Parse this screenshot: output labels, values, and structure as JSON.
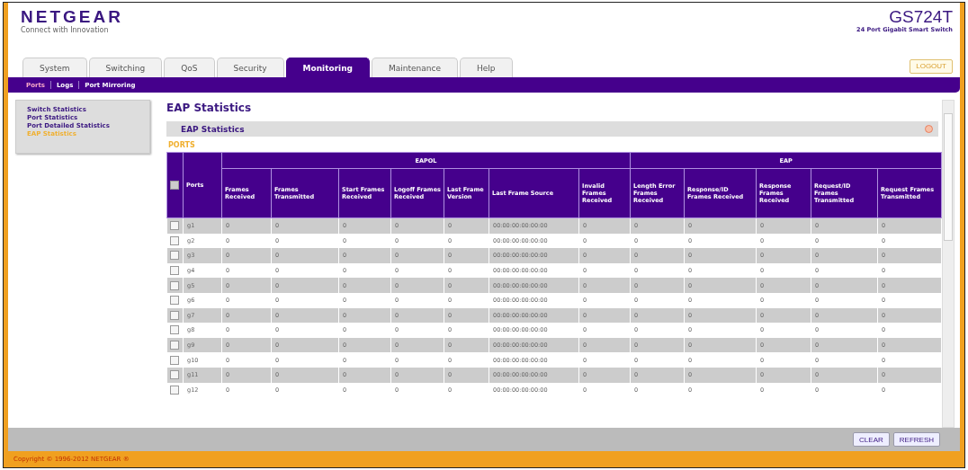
{
  "header": {
    "brand": "NETGEAR",
    "tagline": "Connect with Innovation",
    "model": "GS724T",
    "model_desc": "24 Port Gigabit Smart Switch",
    "logout": "LOGOUT"
  },
  "tabs": [
    {
      "label": "System",
      "selected": false
    },
    {
      "label": "Switching",
      "selected": false
    },
    {
      "label": "QoS",
      "selected": false
    },
    {
      "label": "Security",
      "selected": false
    },
    {
      "label": "Monitoring",
      "selected": true
    },
    {
      "label": "Maintenance",
      "selected": false
    },
    {
      "label": "Help",
      "selected": false
    }
  ],
  "subnav": [
    {
      "label": "Ports",
      "selected": true
    },
    {
      "label": "Logs",
      "selected": false
    },
    {
      "label": "Port Mirroring",
      "selected": false
    }
  ],
  "sidebar": {
    "items": [
      {
        "label": "Switch Statistics",
        "selected": false
      },
      {
        "label": "Port Statistics",
        "selected": false
      },
      {
        "label": "Port Detailed Statistics",
        "selected": false
      },
      {
        "label": "EAP Statistics",
        "selected": true
      }
    ]
  },
  "page_title": "EAP Statistics",
  "panel": {
    "title": "EAP Statistics",
    "section_label": "PORTS",
    "table": {
      "select_all_checked": false,
      "port_column": "Ports",
      "groups": [
        {
          "label": "EAPOL",
          "columns": [
            "Frames Received",
            "Frames Transmitted",
            "Start Frames Received",
            "Logoff Frames Received",
            "Last Frame Version",
            "Last Frame Source",
            "Invalid Frames Received"
          ]
        },
        {
          "label": "EAP",
          "columns": [
            "Length Error Frames Received",
            "Response/ID Frames Received",
            "Response Frames Received",
            "Request/ID Frames Transmitted",
            "Request Frames Transmitted"
          ]
        }
      ],
      "rows": [
        {
          "checked": false,
          "cells": [
            "g1",
            "0",
            "0",
            "0",
            "0",
            "0",
            "00:00:00:00:00:00",
            "0",
            "0",
            "0",
            "0",
            "0",
            "0"
          ]
        },
        {
          "checked": false,
          "cells": [
            "g2",
            "0",
            "0",
            "0",
            "0",
            "0",
            "00:00:00:00:00:00",
            "0",
            "0",
            "0",
            "0",
            "0",
            "0"
          ]
        },
        {
          "checked": false,
          "cells": [
            "g3",
            "0",
            "0",
            "0",
            "0",
            "0",
            "00:00:00:00:00:00",
            "0",
            "0",
            "0",
            "0",
            "0",
            "0"
          ]
        },
        {
          "checked": false,
          "cells": [
            "g4",
            "0",
            "0",
            "0",
            "0",
            "0",
            "00:00:00:00:00:00",
            "0",
            "0",
            "0",
            "0",
            "0",
            "0"
          ]
        },
        {
          "checked": false,
          "cells": [
            "g5",
            "0",
            "0",
            "0",
            "0",
            "0",
            "00:00:00:00:00:00",
            "0",
            "0",
            "0",
            "0",
            "0",
            "0"
          ]
        },
        {
          "checked": false,
          "cells": [
            "g6",
            "0",
            "0",
            "0",
            "0",
            "0",
            "00:00:00:00:00:00",
            "0",
            "0",
            "0",
            "0",
            "0",
            "0"
          ]
        },
        {
          "checked": false,
          "cells": [
            "g7",
            "0",
            "0",
            "0",
            "0",
            "0",
            "00:00:00:00:00:00",
            "0",
            "0",
            "0",
            "0",
            "0",
            "0"
          ]
        },
        {
          "checked": false,
          "cells": [
            "g8",
            "0",
            "0",
            "0",
            "0",
            "0",
            "00:00:00:00:00:00",
            "0",
            "0",
            "0",
            "0",
            "0",
            "0"
          ]
        },
        {
          "checked": false,
          "cells": [
            "g9",
            "0",
            "0",
            "0",
            "0",
            "0",
            "00:00:00:00:00:00",
            "0",
            "0",
            "0",
            "0",
            "0",
            "0"
          ]
        },
        {
          "checked": false,
          "cells": [
            "g10",
            "0",
            "0",
            "0",
            "0",
            "0",
            "00:00:00:00:00:00",
            "0",
            "0",
            "0",
            "0",
            "0",
            "0"
          ]
        },
        {
          "checked": false,
          "cells": [
            "g11",
            "0",
            "0",
            "0",
            "0",
            "0",
            "00:00:00:00:00:00",
            "0",
            "0",
            "0",
            "0",
            "0",
            "0"
          ]
        },
        {
          "checked": false,
          "cells": [
            "g12",
            "0",
            "0",
            "0",
            "0",
            "0",
            "00:00:00:00:00:00",
            "0",
            "0",
            "0",
            "0",
            "0",
            "0"
          ]
        }
      ]
    }
  },
  "buttons": [
    "CLEAR",
    "REFRESH"
  ],
  "footer": "Copyright © 1996-2012 NETGEAR ®"
}
